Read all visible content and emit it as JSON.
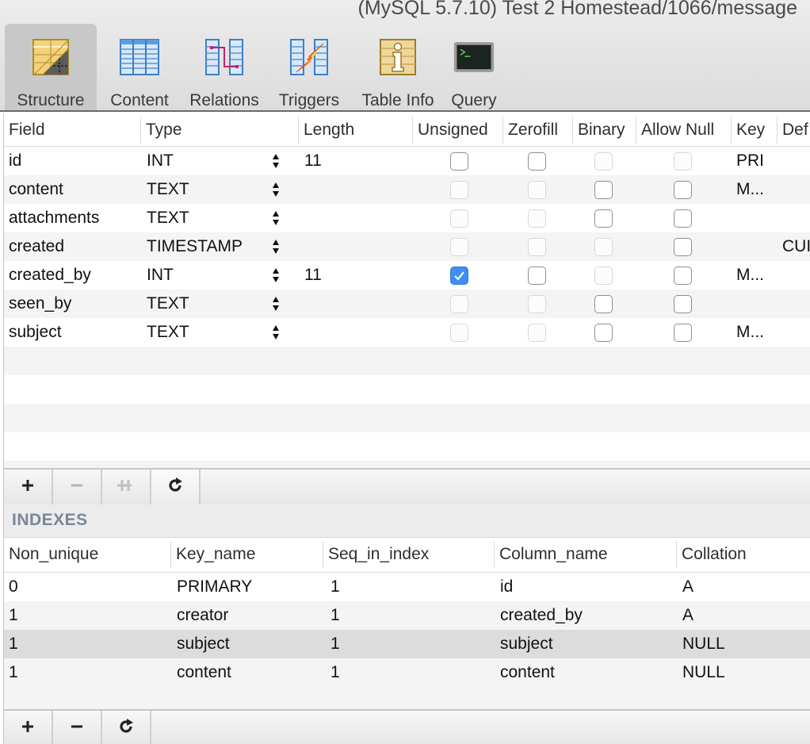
{
  "window": {
    "title": "(MySQL 5.7.10) Test 2 Homestead/1066/message"
  },
  "toolbar": {
    "tabs": [
      {
        "label": "Structure",
        "icon": "structure-icon",
        "active": true
      },
      {
        "label": "Content",
        "icon": "content-table-icon",
        "active": false
      },
      {
        "label": "Relations",
        "icon": "relations-icon",
        "active": false
      },
      {
        "label": "Triggers",
        "icon": "triggers-icon",
        "active": false
      },
      {
        "label": "Table Info",
        "icon": "table-info-icon",
        "active": false
      },
      {
        "label": "Query",
        "icon": "query-terminal-icon",
        "active": false
      }
    ]
  },
  "structure": {
    "columns": [
      "Field",
      "Type",
      "Length",
      "Unsigned",
      "Zerofill",
      "Binary",
      "Allow Null",
      "Key",
      "Def"
    ],
    "rows": [
      {
        "field": "id",
        "type": "INT",
        "length": "11",
        "unsigned": "enabled",
        "zerofill": "enabled",
        "binary": "disabled",
        "allow_null": "disabled",
        "key": "PRI",
        "default": ""
      },
      {
        "field": "content",
        "type": "TEXT",
        "length": "",
        "unsigned": "disabled",
        "zerofill": "disabled",
        "binary": "enabled",
        "allow_null": "enabled",
        "key": "M...",
        "default": ""
      },
      {
        "field": "attachments",
        "type": "TEXT",
        "length": "",
        "unsigned": "disabled",
        "zerofill": "disabled",
        "binary": "enabled",
        "allow_null": "enabled",
        "key": "",
        "default": ""
      },
      {
        "field": "created",
        "type": "TIMESTAMP",
        "length": "",
        "unsigned": "disabled",
        "zerofill": "disabled",
        "binary": "disabled",
        "allow_null": "enabled",
        "key": "",
        "default": "CUI"
      },
      {
        "field": "created_by",
        "type": "INT",
        "length": "11",
        "unsigned": "checked",
        "zerofill": "enabled",
        "binary": "disabled",
        "allow_null": "enabled",
        "key": "M...",
        "default": ""
      },
      {
        "field": "seen_by",
        "type": "TEXT",
        "length": "",
        "unsigned": "disabled",
        "zerofill": "disabled",
        "binary": "enabled",
        "allow_null": "enabled",
        "key": "",
        "default": ""
      },
      {
        "field": "subject",
        "type": "TEXT",
        "length": "",
        "unsigned": "disabled",
        "zerofill": "disabled",
        "binary": "enabled",
        "allow_null": "enabled",
        "key": "M...",
        "default": ""
      }
    ],
    "buttons": [
      {
        "name": "add-field-button",
        "icon": "plus-icon",
        "enabled": true
      },
      {
        "name": "remove-field-button",
        "icon": "minus-icon",
        "enabled": false
      },
      {
        "name": "duplicate-field-button",
        "icon": "duplicate-icon",
        "enabled": false
      },
      {
        "name": "refresh-structure-button",
        "icon": "refresh-icon",
        "enabled": true
      }
    ]
  },
  "indexes": {
    "title": "INDEXES",
    "columns": [
      "Non_unique",
      "Key_name",
      "Seq_in_index",
      "Column_name",
      "Collation"
    ],
    "rows": [
      {
        "non_unique": "0",
        "key_name": "PRIMARY",
        "seq_in_index": "1",
        "column_name": "id",
        "collation": "A",
        "selected": false
      },
      {
        "non_unique": "1",
        "key_name": "creator",
        "seq_in_index": "1",
        "column_name": "created_by",
        "collation": "A",
        "selected": false
      },
      {
        "non_unique": "1",
        "key_name": "subject",
        "seq_in_index": "1",
        "column_name": "subject",
        "collation": "NULL",
        "selected": true
      },
      {
        "non_unique": "1",
        "key_name": "content",
        "seq_in_index": "1",
        "column_name": "content",
        "collation": "NULL",
        "selected": false
      }
    ],
    "buttons": [
      {
        "name": "add-index-button",
        "icon": "plus-icon",
        "enabled": true
      },
      {
        "name": "remove-index-button",
        "icon": "minus-icon",
        "enabled": true
      },
      {
        "name": "refresh-indexes-button",
        "icon": "refresh-icon",
        "enabled": true
      }
    ]
  }
}
